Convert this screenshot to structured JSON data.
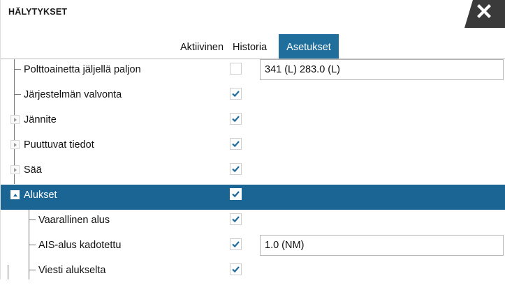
{
  "window": {
    "title": "HÄLYTYKSET"
  },
  "tabs": [
    {
      "label": "Aktiivinen",
      "active": false
    },
    {
      "label": "Historia",
      "active": false
    },
    {
      "label": "Asetukset",
      "active": true
    }
  ],
  "rows": [
    {
      "label": "Polttoainetta jäljellä paljon",
      "checked": false,
      "value": "341 (L)  283.0 (L)"
    },
    {
      "label": "Järjestelmän valvonta",
      "checked": true
    },
    {
      "label": "Jännite",
      "checked": true,
      "expander": "collapsed"
    },
    {
      "label": "Puuttuvat tiedot",
      "checked": true,
      "expander": "collapsed"
    },
    {
      "label": "Sää",
      "checked": true,
      "expander": "collapsed"
    },
    {
      "label": "Alukset",
      "checked": true,
      "expander": "expanded",
      "selected": true
    },
    {
      "label": "Vaarallinen alus",
      "checked": true
    },
    {
      "label": "AIS-alus kadotettu",
      "checked": true,
      "value": "1.0 (NM)"
    },
    {
      "label": "Viesti alukselta",
      "checked": true
    }
  ],
  "colors": {
    "accent": "#1b6595",
    "tab_active": "#1f6e9c",
    "check": "#1f6e9c",
    "close_bg": "#3a3a3a"
  }
}
